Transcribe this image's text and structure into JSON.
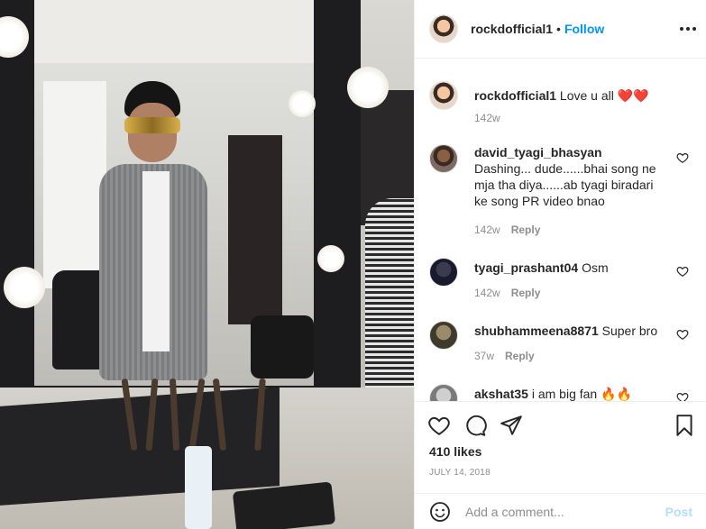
{
  "post": {
    "username": "rockdofficial1",
    "dot": "•",
    "follow_label": "Follow",
    "caption_username": "rockdofficial1",
    "caption_text": "Love u all ❤️❤️",
    "caption_time": "142w"
  },
  "comments": [
    {
      "username": "david_tyagi_bhasyan",
      "text": "Dashing... dude......bhai song ne mja tha diya......ab tyagi biradari ke song PR video bnao",
      "time": "142w",
      "reply": "Reply"
    },
    {
      "username": "tyagi_prashant04",
      "text": "Osm",
      "time": "142w",
      "reply": "Reply"
    },
    {
      "username": "shubhammeena8871",
      "text": "Super bro",
      "time": "37w",
      "reply": "Reply"
    },
    {
      "username": "akshat35",
      "text": "i am big fan 🔥🔥",
      "time": "",
      "reply": ""
    }
  ],
  "footer": {
    "likes": "410 likes",
    "date": "July 14, 2018",
    "comment_placeholder": "Add a comment...",
    "post_label": "Post"
  },
  "icons": {
    "like": "heart-icon",
    "comment": "comment-icon",
    "share": "share-icon",
    "save": "bookmark-icon",
    "more": "more-options-icon",
    "emoji": "emoji-icon"
  },
  "colors": {
    "accent": "#0095f6",
    "post_disabled": "#b2dffc",
    "meta": "#8e8e8e",
    "text": "#262626",
    "heart": "#ed4956"
  }
}
